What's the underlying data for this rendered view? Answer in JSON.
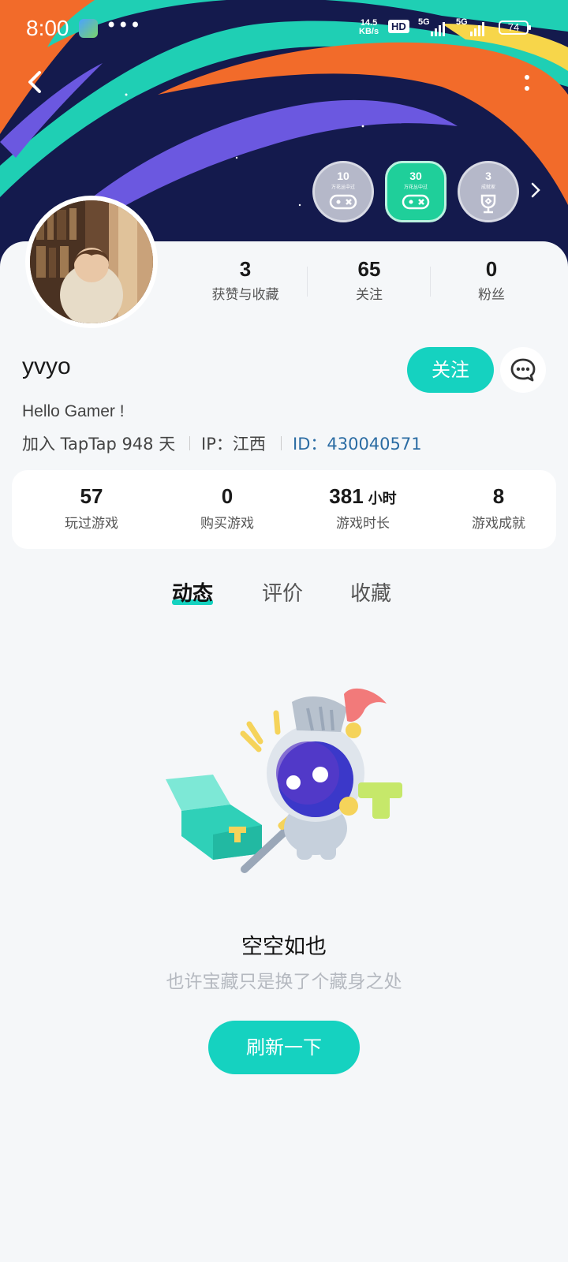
{
  "status_bar": {
    "time": "8:00",
    "net_speed_value": "14.5",
    "net_speed_unit": "KB/s",
    "hd_label": "HD",
    "sim1_label": "5G",
    "sim2_label": "5G",
    "battery": "74"
  },
  "badges": [
    {
      "num": "10",
      "label": "万花丛中过"
    },
    {
      "num": "30",
      "label": "万花丛中过"
    },
    {
      "num": "3",
      "label": "成就家"
    }
  ],
  "profile": {
    "username": "yvyo",
    "bio": "Hello Gamer !",
    "join_text": "加入 TapTap 948 天",
    "ip_text": "IP：江西",
    "id_text": "ID：430040571",
    "follow_button": "关注"
  },
  "social_stats": [
    {
      "value": "3",
      "label": "获赞与收藏"
    },
    {
      "value": "65",
      "label": "关注"
    },
    {
      "value": "0",
      "label": "粉丝"
    }
  ],
  "game_stats": [
    {
      "value": "57",
      "unit": "",
      "label": "玩过游戏"
    },
    {
      "value": "0",
      "unit": "",
      "label": "购买游戏"
    },
    {
      "value": "381",
      "unit": "小时",
      "label": "游戏时长"
    },
    {
      "value": "8",
      "unit": "",
      "label": "游戏成就"
    }
  ],
  "tabs": [
    {
      "label": "动态",
      "active": true
    },
    {
      "label": "评价",
      "active": false
    },
    {
      "label": "收藏",
      "active": false
    }
  ],
  "empty_state": {
    "title": "空空如也",
    "subtitle": "也许宝藏只是换了个藏身之处",
    "button": "刷新一下"
  },
  "colors": {
    "accent": "#15d2c0",
    "id_link": "#2b6ca3",
    "banner_bg": "#141a4d"
  }
}
